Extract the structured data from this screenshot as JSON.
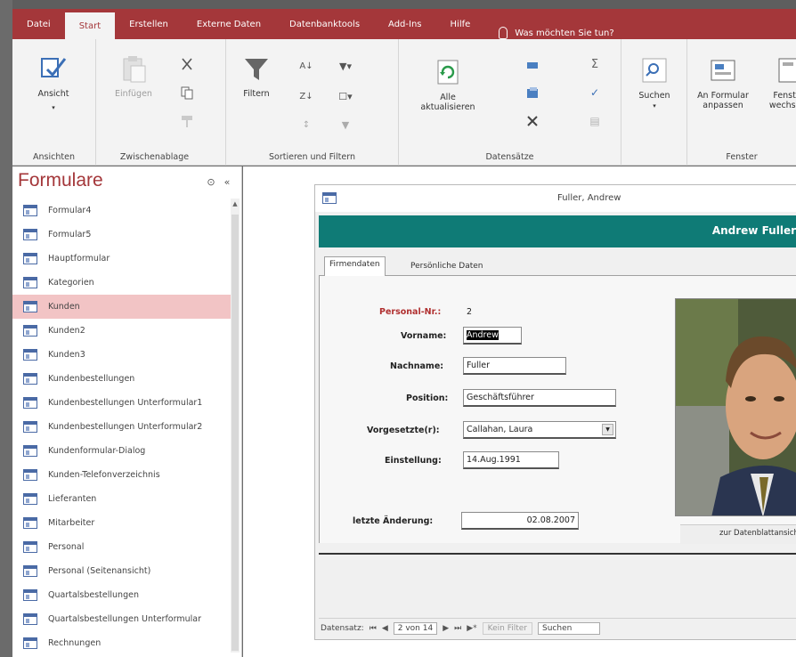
{
  "ribbon": {
    "tabs": [
      "Datei",
      "Start",
      "Erstellen",
      "Externe Daten",
      "Datenbanktools",
      "Add-Ins",
      "Hilfe"
    ],
    "active_tab": "Start",
    "tell_me": "Was möchten Sie tun?",
    "groups": {
      "ansichten": {
        "label": "Ansichten",
        "ansicht": "Ansicht"
      },
      "zwischenablage": {
        "label": "Zwischenablage",
        "einfuegen": "Einfügen"
      },
      "sortieren": {
        "label": "Sortieren und Filtern",
        "filtern": "Filtern"
      },
      "datensaetze": {
        "label": "Datensätze",
        "aktualisieren": "Alle aktualisieren"
      },
      "suchen": {
        "suchen": "Suchen"
      },
      "fenster": {
        "label": "Fenster",
        "anpassen": "An Formular anpassen",
        "wechseln": "Fenster wechseln"
      }
    },
    "colors": {
      "brand": "#a4373a",
      "teal": "#0f7b76"
    }
  },
  "nav": {
    "title": "Formulare",
    "items": [
      {
        "label": "Formular4",
        "selected": false
      },
      {
        "label": "Formular5",
        "selected": false
      },
      {
        "label": "Hauptformular",
        "selected": false
      },
      {
        "label": "Kategorien",
        "selected": false
      },
      {
        "label": "Kunden",
        "selected": true
      },
      {
        "label": "Kunden2",
        "selected": false
      },
      {
        "label": "Kunden3",
        "selected": false
      },
      {
        "label": "Kundenbestellungen",
        "selected": false
      },
      {
        "label": "Kundenbestellungen Unterformular1",
        "selected": false
      },
      {
        "label": "Kundenbestellungen Unterformular2",
        "selected": false
      },
      {
        "label": "Kundenformular-Dialog",
        "selected": false
      },
      {
        "label": "Kunden-Telefonverzeichnis",
        "selected": false
      },
      {
        "label": "Lieferanten",
        "selected": false
      },
      {
        "label": "Mitarbeiter",
        "selected": false
      },
      {
        "label": "Personal",
        "selected": false
      },
      {
        "label": "Personal (Seitenansicht)",
        "selected": false
      },
      {
        "label": "Quartalsbestellungen",
        "selected": false
      },
      {
        "label": "Quartalsbestellungen Unterformular",
        "selected": false
      },
      {
        "label": "Rechnungen",
        "selected": false
      }
    ]
  },
  "form": {
    "window_title": "Fuller, Andrew",
    "header": "Andrew Fuller",
    "tabs": [
      "Firmendaten",
      "Persönliche Daten"
    ],
    "active_tab": "Firmendaten",
    "fields": {
      "personal_nr_label": "Personal-Nr.:",
      "personal_nr_value": "2",
      "vorname_label": "Vorname:",
      "vorname_value": "Andrew",
      "nachname_label": "Nachname:",
      "nachname_value": "Fuller",
      "position_label": "Position:",
      "position_value": "Geschäftsführer",
      "vorgesetzter_label": "Vorgesetzte(r):",
      "vorgesetzter_value": "Callahan, Laura",
      "einstellung_label": "Einstellung:",
      "einstellung_value": "14.Aug.1991",
      "letzte_label": "letzte Änderung:",
      "letzte_value": "02.08.2007"
    },
    "photo_button": "zur Datenblattansicht",
    "record_nav": {
      "label": "Datensatz:",
      "position": "2 von 14",
      "filter": "Kein Filter",
      "search": "Suchen"
    }
  }
}
